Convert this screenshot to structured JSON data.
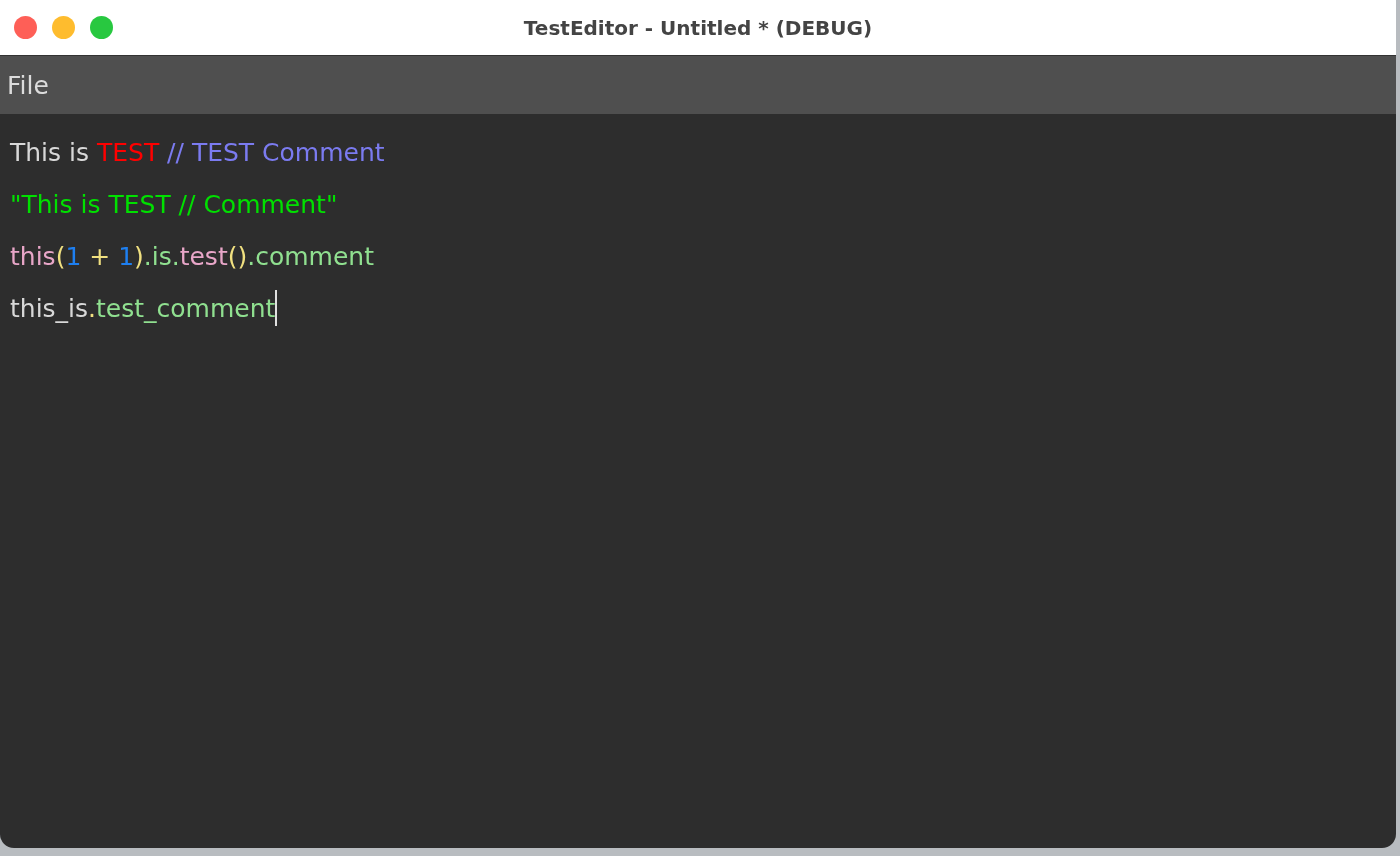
{
  "window": {
    "title": "TestEditor - Untitled * (DEBUG)"
  },
  "menu": [
    {
      "label": "File"
    }
  ],
  "editor": {
    "lines": [
      {
        "caret": false,
        "tokens": [
          {
            "text": "This is ",
            "color": "#d8d8d8"
          },
          {
            "text": "TEST",
            "color": "#ff0000"
          },
          {
            "text": " // TEST Comment",
            "color": "#7b7bf0"
          }
        ]
      },
      {
        "caret": false,
        "tokens": [
          {
            "text": "\"This is TEST // Comment\"",
            "color": "#00e000"
          }
        ]
      },
      {
        "caret": false,
        "tokens": [
          {
            "text": "this",
            "color": "#e8a6c8"
          },
          {
            "text": "(",
            "color": "#f0e080"
          },
          {
            "text": "1",
            "color": "#1e7ff0"
          },
          {
            "text": " + ",
            "color": "#f0e080"
          },
          {
            "text": "1",
            "color": "#1e7ff0"
          },
          {
            "text": ")",
            "color": "#f0e080"
          },
          {
            "text": ".is.",
            "color": "#90e090"
          },
          {
            "text": "test",
            "color": "#e8a6c8"
          },
          {
            "text": "()",
            "color": "#f0e080"
          },
          {
            "text": ".comment",
            "color": "#90e090"
          }
        ]
      },
      {
        "caret": true,
        "tokens": [
          {
            "text": "this_is",
            "color": "#d8d8d8"
          },
          {
            "text": ".",
            "color": "#f0e080"
          },
          {
            "text": "test_comment",
            "color": "#90e090"
          }
        ]
      }
    ]
  }
}
